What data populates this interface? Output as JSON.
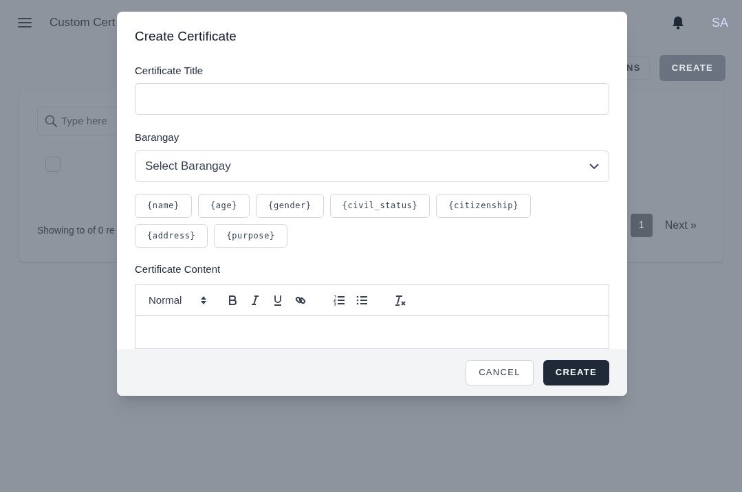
{
  "header": {
    "title": "Custom Cert",
    "avatar": "SA"
  },
  "toolbar": {
    "buttons": [
      {
        "label": "NS",
        "kind": "outline"
      },
      {
        "label": "CREATE",
        "kind": "dark"
      }
    ]
  },
  "list": {
    "search": {
      "placeholder": "Type here"
    },
    "select_all": {
      "checked": false
    },
    "summary": "Showing to of 0 re",
    "pagination": [
      {
        "label": "1",
        "selected": true
      },
      {
        "label": "Next »",
        "selected": false
      }
    ]
  },
  "modal": {
    "title": "Create Certificate",
    "fields": [
      {
        "label": "Certificate Title",
        "kind": "text"
      },
      {
        "label": "Barangay",
        "kind": "select",
        "value": "Select Barangay"
      }
    ],
    "placeholders": [
      "{name}",
      "{age}",
      "{gender}",
      "{civil_status}",
      "{citizenship}",
      "{address}",
      "{purpose}"
    ],
    "content_label": "Certificate Content",
    "editor": {
      "format": "Normal"
    },
    "buttons": [
      {
        "label": "CANCEL",
        "kind": "outline"
      },
      {
        "label": "CREATE",
        "kind": "dark"
      }
    ]
  }
}
